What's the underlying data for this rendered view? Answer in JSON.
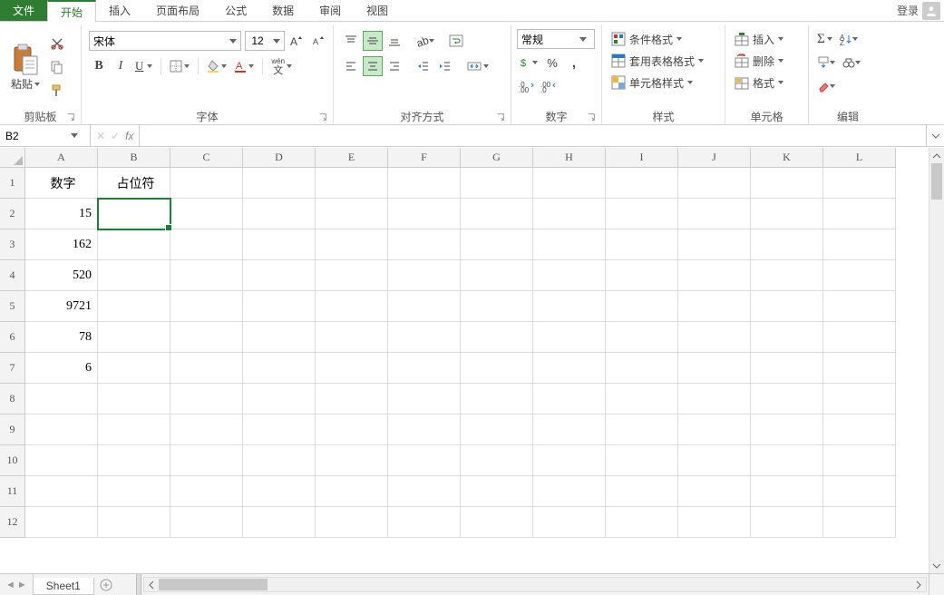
{
  "menu": {
    "file": "文件",
    "tabs": [
      "开始",
      "插入",
      "页面布局",
      "公式",
      "数据",
      "审阅",
      "视图"
    ],
    "active_index": 0,
    "login": "登录"
  },
  "ribbon": {
    "clipboard": {
      "paste": "粘贴",
      "label": "剪贴板"
    },
    "font": {
      "name": "宋体",
      "size": "12",
      "bold": "B",
      "italic": "I",
      "underline": "U",
      "pinyin": "wén",
      "label": "字体"
    },
    "alignment": {
      "label": "对齐方式"
    },
    "number": {
      "format": "常规",
      "label": "数字"
    },
    "styles": {
      "conditional": "条件格式",
      "format_table": "套用表格格式",
      "cell_styles": "单元格样式",
      "label": "样式"
    },
    "cells": {
      "insert": "插入",
      "delete": "删除",
      "format": "格式",
      "label": "单元格"
    },
    "editing": {
      "label": "编辑"
    }
  },
  "formula_bar": {
    "name_box": "B2",
    "cancel": "✕",
    "enter": "✓",
    "fx": "fx",
    "formula": ""
  },
  "grid": {
    "columns": [
      "A",
      "B",
      "C",
      "D",
      "E",
      "F",
      "G",
      "H",
      "I",
      "J",
      "K",
      "L"
    ],
    "rows": [
      "1",
      "2",
      "3",
      "4",
      "5",
      "6",
      "7",
      "8",
      "9",
      "10",
      "11",
      "12"
    ],
    "data": {
      "A1": "数字",
      "B1": "占位符",
      "A2": "15",
      "A3": "162",
      "A4": "520",
      "A5": "9721",
      "A6": "78",
      "A7": "6"
    },
    "selected": "B2"
  },
  "sheets": {
    "active": "Sheet1",
    "add": "+"
  }
}
